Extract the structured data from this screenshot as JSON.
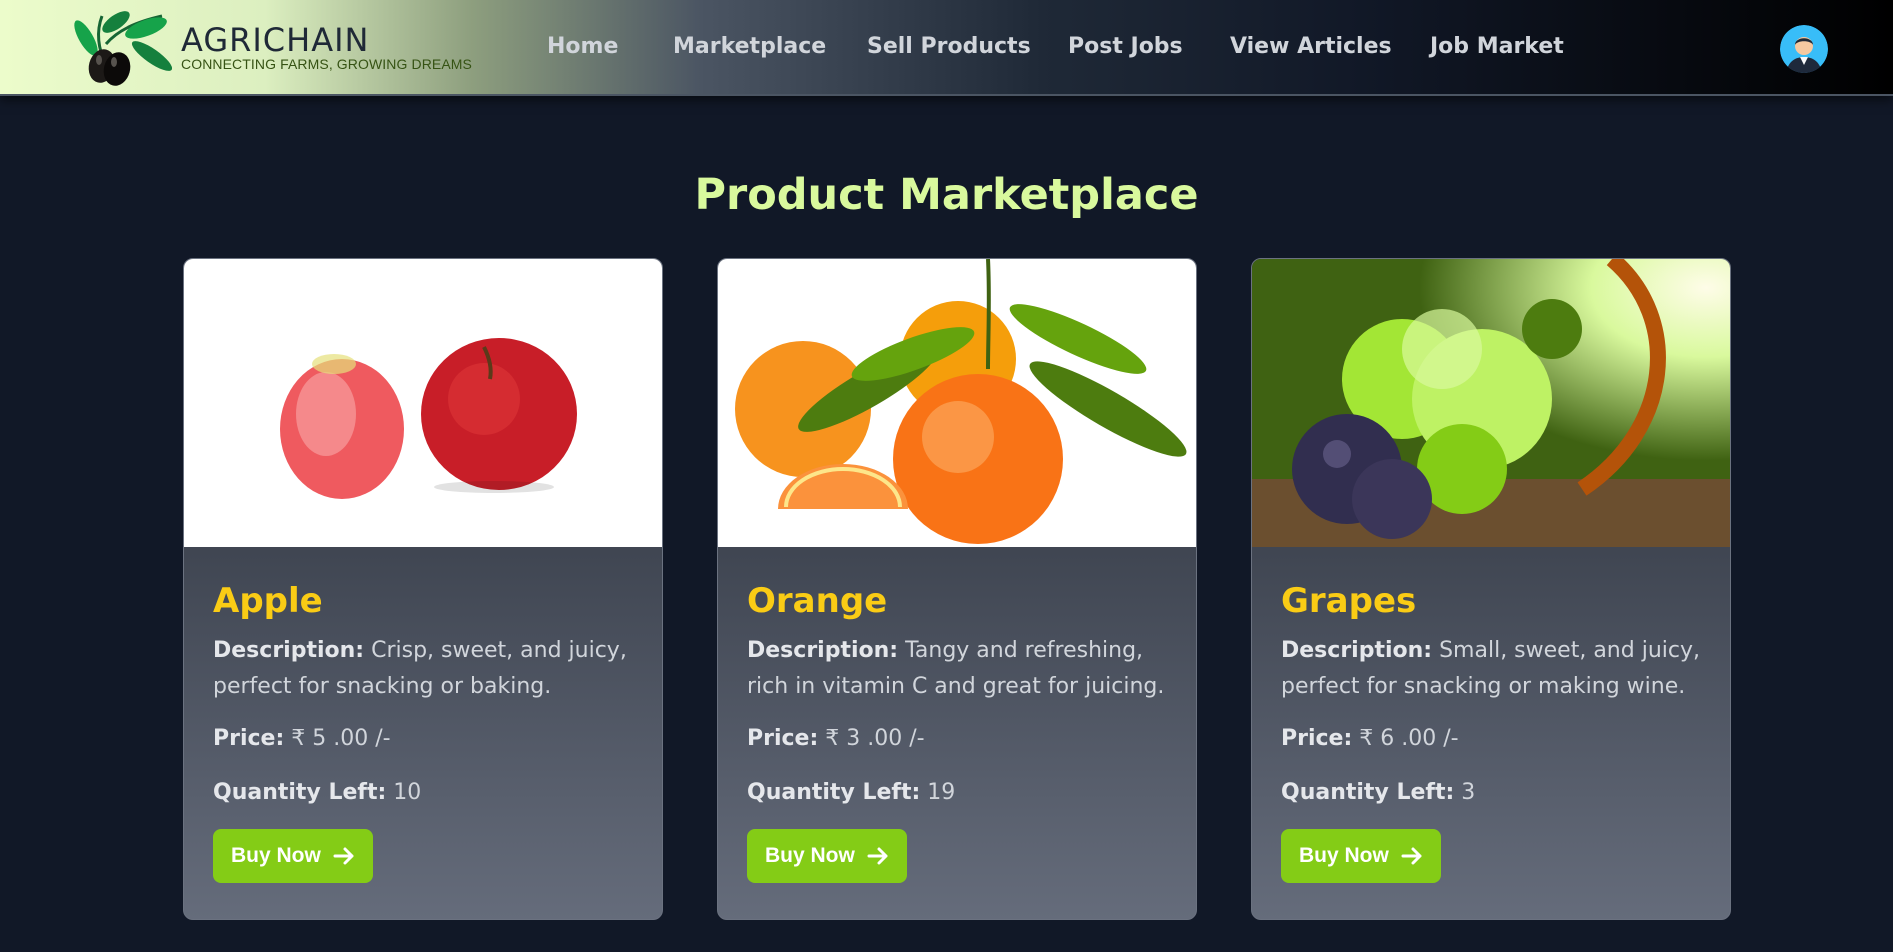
{
  "brand": {
    "name": "AGRICHAIN",
    "tagline": "CONNECTING FARMS, GROWING DREAMS"
  },
  "nav": {
    "items": [
      {
        "label": "Home"
      },
      {
        "label": "Marketplace"
      },
      {
        "label": "Sell Products"
      },
      {
        "label": "Post Jobs"
      },
      {
        "label": "View Articles"
      },
      {
        "label": "Job Market"
      }
    ],
    "avatar_icon": "user-avatar-icon"
  },
  "page": {
    "title": "Product Marketplace"
  },
  "labels": {
    "description": "Description:",
    "price": "Price:",
    "quantity": "Quantity Left:",
    "buy": "Buy Now"
  },
  "products": [
    {
      "name": "Apple",
      "description": "Crisp, sweet, and juicy, perfect for snacking or baking.",
      "price": "₹ 5 .00 /-",
      "quantity": "10"
    },
    {
      "name": "Orange",
      "description": "Tangy and refreshing, rich in vitamin C and great for juicing.",
      "price": "₹ 3 .00 /-",
      "quantity": "19"
    },
    {
      "name": "Grapes",
      "description": "Small, sweet, and juicy, perfect for snacking or making wine.",
      "price": "₹ 6 .00 /-",
      "quantity": "3"
    }
  ],
  "colors": {
    "background": "#111827",
    "title": "#d9f99d",
    "product_name": "#facc15",
    "button": "#84cc16"
  }
}
